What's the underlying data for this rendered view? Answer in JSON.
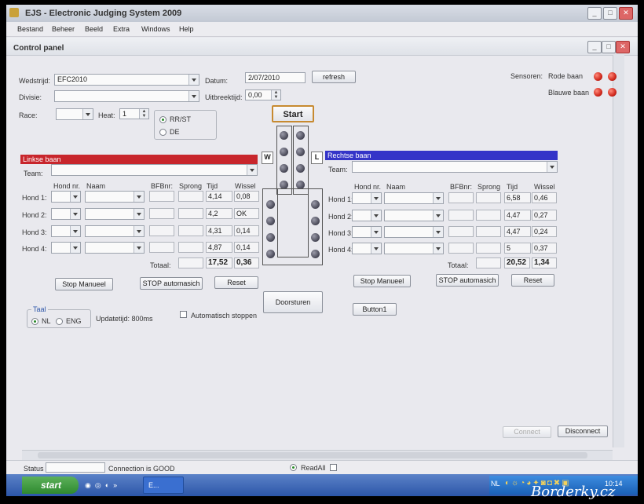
{
  "window": {
    "title": "EJS - Electronic Judging System 2009"
  },
  "menu": [
    "Bestand",
    "Beheer",
    "Beeld",
    "Extra",
    "Windows",
    "Help"
  ],
  "panel": {
    "title": "Control panel"
  },
  "form": {
    "wedstrijd_label": "Wedstrijd:",
    "wedstrijd_value": "EFC2010",
    "divisie_label": "Divisie:",
    "race_label": "Race:",
    "heat_label": "Heat:",
    "heat_value": "1",
    "datum_label": "Datum:",
    "datum_value": "2/07/2010",
    "refresh_label": "refresh",
    "uitbreektijd_label": "Uitbreektijd:",
    "uitbreektijd_value": "0,00",
    "mode_options": [
      "RR/ST",
      "DE"
    ],
    "start_label": "Start"
  },
  "sensors": {
    "label": "Sensoren:",
    "rode": "Rode baan",
    "blauwe": "Blauwe baan"
  },
  "left": {
    "header": "Linkse baan",
    "team_label": "Team:",
    "columns": [
      "Hond nr.",
      "Naam",
      "BFBnr:",
      "Sprong",
      "Tijd",
      "Wissel"
    ],
    "rows": [
      {
        "label": "Hond 1:",
        "tijd": "4,14",
        "wissel": "0,08"
      },
      {
        "label": "Hond 2:",
        "tijd": "4,2",
        "wissel": "OK"
      },
      {
        "label": "Hond 3:",
        "tijd": "4,31",
        "wissel": "0,14"
      },
      {
        "label": "Hond 4:",
        "tijd": "4,87",
        "wissel": "0,14"
      }
    ],
    "totaal_label": "Totaal:",
    "totaal_tijd": "17,52",
    "totaal_wissel": "0,36",
    "buttons": [
      "Stop Manueel",
      "STOP automasich",
      "Reset"
    ]
  },
  "right": {
    "header": "Rechtse baan",
    "team_label": "Team:",
    "columns": [
      "Hond nr.",
      "Naam",
      "BFBnr:",
      "Sprong",
      "Tijd",
      "Wissel"
    ],
    "rows": [
      {
        "label": "Hond 1:",
        "tijd": "6,58",
        "wissel": "0,46"
      },
      {
        "label": "Hond 2:",
        "tijd": "4,47",
        "wissel": "0,27"
      },
      {
        "label": "Hond 3:",
        "tijd": "4,47",
        "wissel": "0,24"
      },
      {
        "label": "Hond 4:",
        "tijd": "5",
        "wissel": "0,37"
      }
    ],
    "totaal_label": "Totaal:",
    "totaal_tijd": "20,52",
    "totaal_wissel": "1,34",
    "buttons": [
      "Stop Manueel",
      "STOP automasich",
      "Reset"
    ]
  },
  "lane_letters": {
    "w": "W",
    "l": "L"
  },
  "doorsturen_label": "Doorsturen",
  "button1_label": "Button1",
  "taal": {
    "legend": "Taal",
    "options": [
      "NL",
      "ENG"
    ]
  },
  "updatetijd": "Updatetijd: 800ms",
  "auto_stop_label": "Automatisch stoppen",
  "connect_label": "Connect",
  "disconnect_label": "Disconnect",
  "status": {
    "label": "Status",
    "connection": "Connection is GOOD",
    "readall": "ReadAll"
  },
  "taskbar": {
    "start": "start",
    "task": "E...",
    "lang": "NL",
    "clock": "10:14"
  },
  "watermark": "Borderky.cz",
  "colors": {
    "left_header": "#c8262c",
    "right_header": "#3434c8",
    "sensor_led": "#d0281c"
  }
}
